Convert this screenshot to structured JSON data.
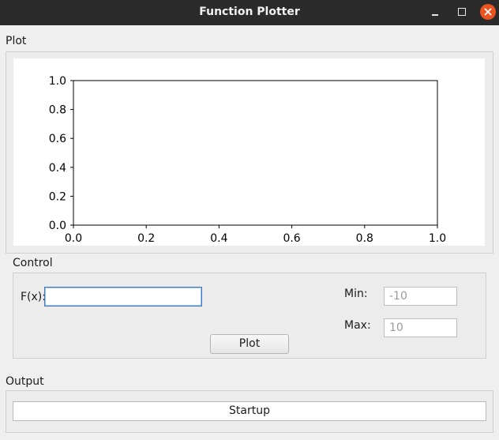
{
  "window": {
    "title": "Function Plotter",
    "controls": {
      "minimize_icon": "minimize-icon",
      "maximize_icon": "maximize-icon",
      "close_icon": "close-icon"
    },
    "accent": "#e95420"
  },
  "plot_group": {
    "label": "Plot",
    "chart_data": {
      "type": "line",
      "title": "",
      "xlabel": "",
      "ylabel": "",
      "xlim": [
        0.0,
        1.0
      ],
      "ylim": [
        0.0,
        1.0
      ],
      "xticks": [
        "0.0",
        "0.2",
        "0.4",
        "0.6",
        "0.8",
        "1.0"
      ],
      "yticks": [
        "0.0",
        "0.2",
        "0.4",
        "0.6",
        "0.8",
        "1.0"
      ],
      "series": [],
      "grid": false
    }
  },
  "control_group": {
    "label": "Control",
    "fx_label": "F(x):",
    "fx_value": "",
    "min_label": "Min:",
    "min_placeholder": "-10",
    "max_label": "Max:",
    "max_placeholder": "10",
    "plot_button": "Plot"
  },
  "output_group": {
    "label": "Output",
    "status": "Startup"
  }
}
